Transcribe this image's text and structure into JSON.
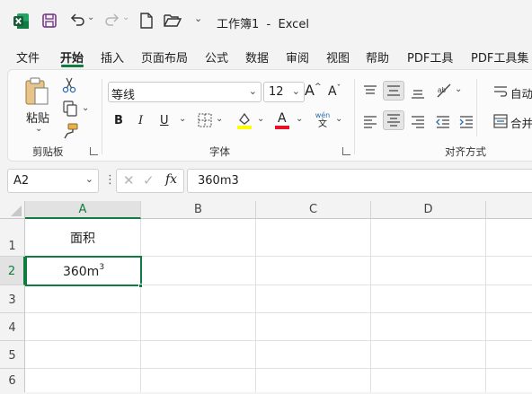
{
  "titlebar": {
    "title": "工作簿1  -  Excel"
  },
  "tabs": [
    "文件",
    "开始",
    "插入",
    "页面布局",
    "公式",
    "数据",
    "审阅",
    "视图",
    "帮助",
    "PDF工具",
    "PDF工具集"
  ],
  "ribbon": {
    "clipboard": {
      "paste_label": "粘贴",
      "group_label": "剪贴板"
    },
    "font": {
      "font_name": "等线",
      "font_size": "12",
      "group_label": "字体",
      "phonetic_top": "wén",
      "phonetic_bottom": "文"
    },
    "alignment": {
      "group_label": "对齐方式",
      "wrap_label": "自动",
      "merge_label": "合并"
    }
  },
  "formula_bar": {
    "name_box": "A2",
    "fx": "fx",
    "content": "360m3"
  },
  "grid": {
    "columns": [
      "A",
      "B",
      "C",
      "D"
    ],
    "rows": [
      "1",
      "2",
      "3",
      "4",
      "5",
      "6"
    ],
    "cells": {
      "A1": "面积",
      "A2_base": "360m",
      "A2_sup": "3"
    }
  },
  "colors": {
    "accent": "#107c41",
    "highlight_yellow": "#ffff00",
    "font_red": "#e81123"
  }
}
